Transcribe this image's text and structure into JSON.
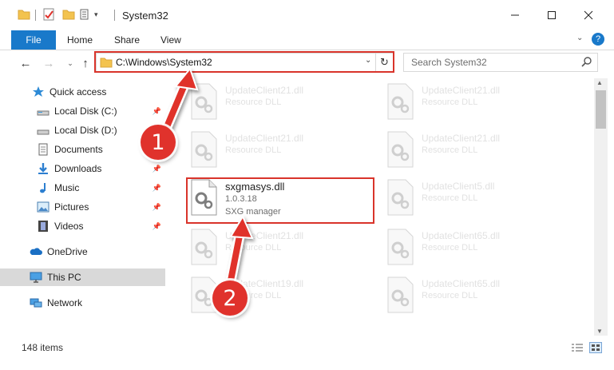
{
  "window": {
    "title": "System32"
  },
  "ribbon": {
    "tabs": [
      "File",
      "Home",
      "Share",
      "View"
    ]
  },
  "address": {
    "path": "C:\\Windows\\System32"
  },
  "search": {
    "placeholder": "Search System32"
  },
  "sidebar": {
    "items": [
      {
        "label": "Quick access",
        "icon": "star-icon"
      },
      {
        "label": "Local Disk (C:)",
        "icon": "drive-icon"
      },
      {
        "label": "Local Disk (D:)",
        "icon": "drive-icon"
      },
      {
        "label": "Documents",
        "icon": "documents-icon"
      },
      {
        "label": "Downloads",
        "icon": "download-icon"
      },
      {
        "label": "Music",
        "icon": "music-icon"
      },
      {
        "label": "Pictures",
        "icon": "pictures-icon"
      },
      {
        "label": "Videos",
        "icon": "videos-icon"
      },
      {
        "label": "OneDrive",
        "icon": "cloud-icon"
      },
      {
        "label": "This PC",
        "icon": "computer-icon"
      },
      {
        "label": "Network",
        "icon": "network-icon"
      }
    ]
  },
  "files": {
    "col1": [
      {
        "name": "UpdateClient21.dll",
        "desc": "Resource DLL"
      },
      {
        "name": "UpdateClient21.dll",
        "desc": "Resource DLL"
      },
      {
        "name": "UpdateClient21.dll",
        "desc": "Resource DLL"
      },
      {
        "name": "UpdateClient19.dll",
        "desc": "Resource DLL"
      }
    ],
    "col2": [
      {
        "name": "UpdateClient21.dll",
        "desc": "Resource DLL"
      },
      {
        "name": "UpdateClient21.dll",
        "desc": "Resource DLL"
      },
      {
        "name": "UpdateClient5.dll",
        "desc": "Resource DLL"
      },
      {
        "name": "UpdateClient65.dll",
        "desc": "Resource DLL"
      },
      {
        "name": "UpdateClient65.dll",
        "desc": "Resource DLL"
      }
    ],
    "selected": {
      "name": "sxgmasys.dll",
      "version": "1.0.3.18",
      "desc": "SXG manager"
    }
  },
  "status": {
    "count": "148 items"
  },
  "callouts": [
    "1",
    "2"
  ],
  "colors": {
    "accent": "#1979ca",
    "highlight": "#d9342b",
    "callout": "#e0322c"
  }
}
